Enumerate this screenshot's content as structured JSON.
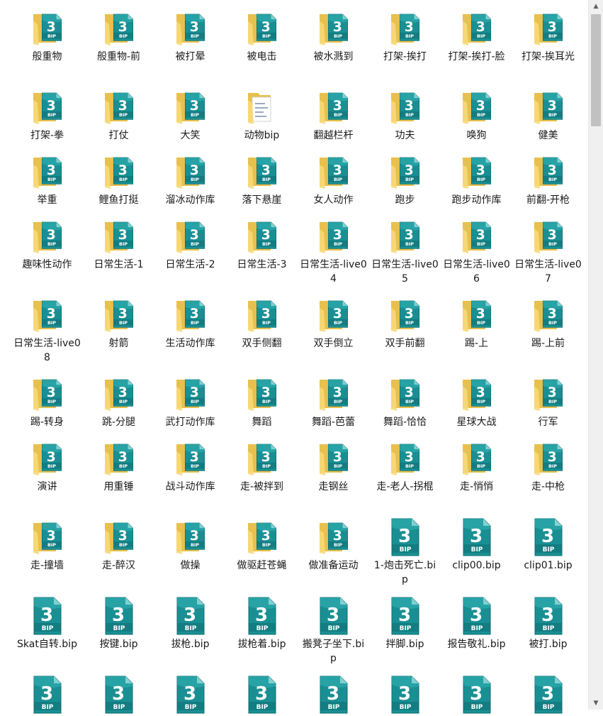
{
  "items": [
    {
      "label": "般重物",
      "type": "bip-folder"
    },
    {
      "label": "般重物-前",
      "type": "bip-folder"
    },
    {
      "label": "被打晕",
      "type": "bip-folder"
    },
    {
      "label": "被电击",
      "type": "bip-folder"
    },
    {
      "label": "被水溅到",
      "type": "bip-folder"
    },
    {
      "label": "打架-挨打",
      "type": "bip-folder"
    },
    {
      "label": "打架-挨打-脸",
      "type": "bip-folder"
    },
    {
      "label": "打架-挨耳光",
      "type": "bip-folder"
    },
    {
      "label": "打架-拳",
      "type": "bip-folder"
    },
    {
      "label": "打仗",
      "type": "bip-folder"
    },
    {
      "label": "大笑",
      "type": "bip-folder"
    },
    {
      "label": "动物bip",
      "type": "plain-folder"
    },
    {
      "label": "翻越栏杆",
      "type": "bip-folder"
    },
    {
      "label": "功夫",
      "type": "bip-folder"
    },
    {
      "label": "唤狗",
      "type": "bip-folder"
    },
    {
      "label": "健美",
      "type": "bip-folder"
    },
    {
      "label": "举重",
      "type": "bip-folder"
    },
    {
      "label": "鲤鱼打挺",
      "type": "bip-folder"
    },
    {
      "label": "溜冰动作库",
      "type": "bip-folder"
    },
    {
      "label": "落下悬崖",
      "type": "bip-folder"
    },
    {
      "label": "女人动作",
      "type": "bip-folder"
    },
    {
      "label": "跑步",
      "type": "bip-folder"
    },
    {
      "label": "跑步动作库",
      "type": "bip-folder"
    },
    {
      "label": "前翻-开枪",
      "type": "bip-folder"
    },
    {
      "label": "趣味性动作",
      "type": "bip-folder"
    },
    {
      "label": "日常生活-1",
      "type": "bip-folder"
    },
    {
      "label": "日常生活-2",
      "type": "bip-folder"
    },
    {
      "label": "日常生活-3",
      "type": "bip-folder"
    },
    {
      "label": "日常生活-live04",
      "type": "bip-folder"
    },
    {
      "label": "日常生活-live05",
      "type": "bip-folder"
    },
    {
      "label": "日常生活-live06",
      "type": "bip-folder"
    },
    {
      "label": "日常生活-live07",
      "type": "bip-folder"
    },
    {
      "label": "日常生活-live08",
      "type": "bip-folder"
    },
    {
      "label": "射箭",
      "type": "bip-folder"
    },
    {
      "label": "生活动作库",
      "type": "bip-folder"
    },
    {
      "label": "双手侧翻",
      "type": "bip-folder"
    },
    {
      "label": "双手倒立",
      "type": "bip-folder"
    },
    {
      "label": "双手前翻",
      "type": "bip-folder"
    },
    {
      "label": "踢-上",
      "type": "bip-folder"
    },
    {
      "label": "踢-上前",
      "type": "bip-folder"
    },
    {
      "label": "踢-转身",
      "type": "bip-folder"
    },
    {
      "label": "跳-分腿",
      "type": "bip-folder"
    },
    {
      "label": "武打动作库",
      "type": "bip-folder"
    },
    {
      "label": "舞蹈",
      "type": "bip-folder"
    },
    {
      "label": "舞蹈-芭蕾",
      "type": "bip-folder"
    },
    {
      "label": "舞蹈-恰恰",
      "type": "bip-folder"
    },
    {
      "label": "星球大战",
      "type": "bip-folder"
    },
    {
      "label": "行军",
      "type": "bip-folder"
    },
    {
      "label": "演讲",
      "type": "bip-folder"
    },
    {
      "label": "用重锤",
      "type": "bip-folder"
    },
    {
      "label": "战斗动作库",
      "type": "bip-folder"
    },
    {
      "label": "走-被拌到",
      "type": "bip-folder"
    },
    {
      "label": "走钢丝",
      "type": "bip-folder"
    },
    {
      "label": "走-老人-拐棍",
      "type": "bip-folder"
    },
    {
      "label": "走-悄悄",
      "type": "bip-folder"
    },
    {
      "label": "走-中枪",
      "type": "bip-folder"
    },
    {
      "label": "走-撞墙",
      "type": "bip-folder"
    },
    {
      "label": "走-醉汉",
      "type": "bip-folder"
    },
    {
      "label": "做操",
      "type": "bip-folder"
    },
    {
      "label": "做驱赶苍蝇",
      "type": "bip-folder"
    },
    {
      "label": "做准备运动",
      "type": "bip-folder"
    },
    {
      "label": "1-炮击死亡.bip",
      "type": "bip-file"
    },
    {
      "label": "clip00.bip",
      "type": "bip-file"
    },
    {
      "label": "clip01.bip",
      "type": "bip-file"
    },
    {
      "label": "Skat自转.bip",
      "type": "bip-file"
    },
    {
      "label": "按键.bip",
      "type": "bip-file"
    },
    {
      "label": "拔枪.bip",
      "type": "bip-file"
    },
    {
      "label": "拔枪着.bip",
      "type": "bip-file"
    },
    {
      "label": "搬凳子坐下.bip",
      "type": "bip-file"
    },
    {
      "label": "拌脚.bip",
      "type": "bip-file"
    },
    {
      "label": "报告敬礼.bip",
      "type": "bip-file"
    },
    {
      "label": "被打.bip",
      "type": "bip-file"
    },
    {
      "label": "",
      "type": "bip-file"
    },
    {
      "label": "",
      "type": "bip-file"
    },
    {
      "label": "",
      "type": "bip-file"
    },
    {
      "label": "",
      "type": "bip-file"
    },
    {
      "label": "",
      "type": "bip-file"
    },
    {
      "label": "",
      "type": "bip-file"
    },
    {
      "label": "",
      "type": "bip-file"
    },
    {
      "label": "",
      "type": "bip-file"
    }
  ],
  "icon_text": {
    "number": "3",
    "ext": "BIP"
  },
  "colors": {
    "folder_back": "#e8c04e",
    "folder_front": "#f7d978",
    "doc_teal": "#1a8f93",
    "doc_teal_dark": "#0f6f72",
    "label_text": "#1a1a1a",
    "scrollbar_track": "#f0f0f0",
    "scrollbar_thumb": "#c1c1c1"
  },
  "scrollbar": {
    "up_arrow": "▲",
    "down_arrow": "▼"
  }
}
